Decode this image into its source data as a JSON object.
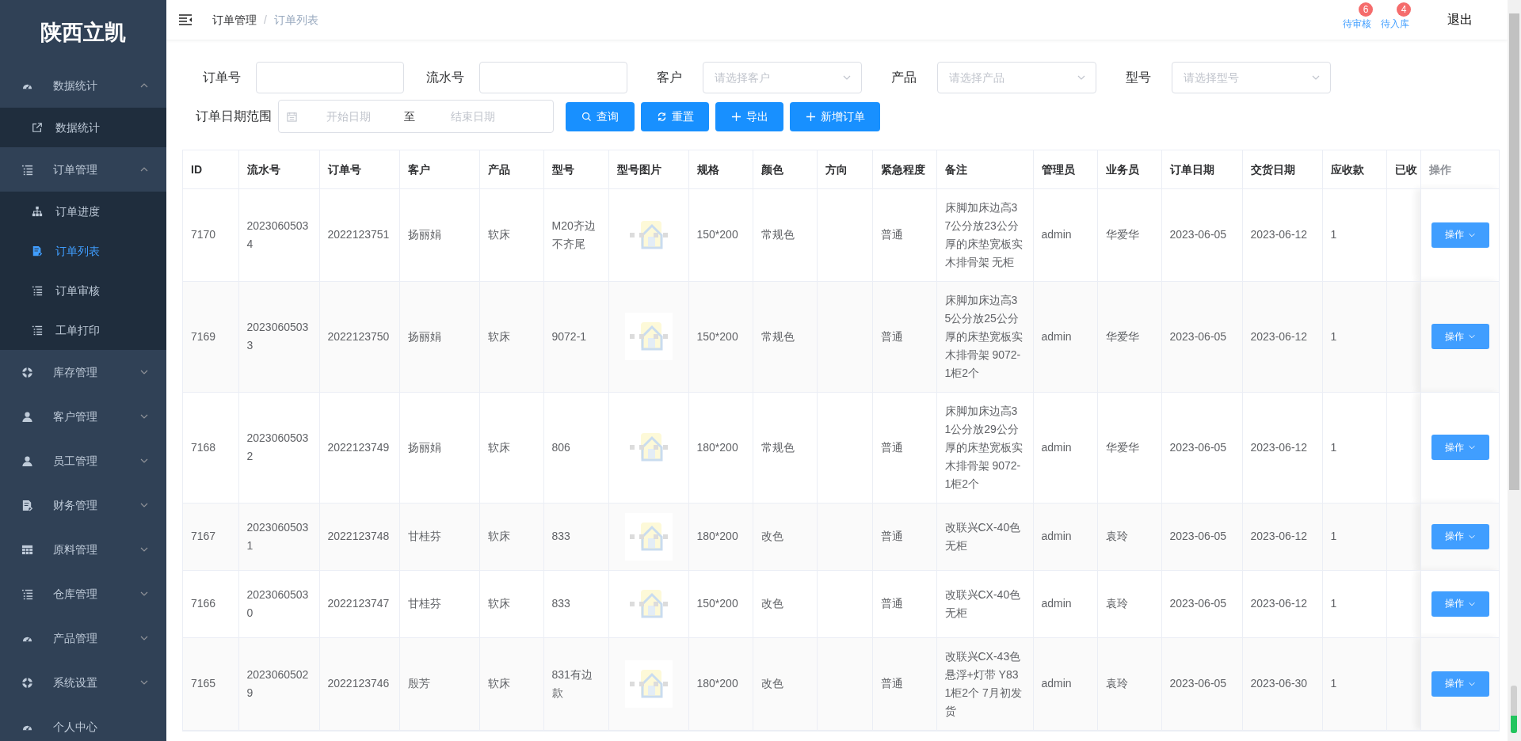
{
  "sidebar": {
    "logo": "陕西立凯",
    "items": [
      {
        "label": "数据统计",
        "expanded": true,
        "children": [
          {
            "label": "数据统计",
            "selected": false
          }
        ]
      },
      {
        "label": "订单管理",
        "expanded": true,
        "children": [
          {
            "label": "订单进度",
            "selected": false
          },
          {
            "label": "订单列表",
            "selected": true
          },
          {
            "label": "订单审核",
            "selected": false
          },
          {
            "label": "工单打印",
            "selected": false
          }
        ]
      },
      {
        "label": "库存管理",
        "expanded": false
      },
      {
        "label": "客户管理",
        "expanded": false
      },
      {
        "label": "员工管理",
        "expanded": false
      },
      {
        "label": "财务管理",
        "expanded": false
      },
      {
        "label": "原料管理",
        "expanded": false
      },
      {
        "label": "仓库管理",
        "expanded": false
      },
      {
        "label": "产品管理",
        "expanded": false
      },
      {
        "label": "系统设置",
        "expanded": false
      },
      {
        "label": "个人中心"
      }
    ]
  },
  "header": {
    "breadcrumb": [
      "订单管理",
      "订单列表"
    ],
    "breadcrumb_separator": "/",
    "links": [
      {
        "label": "待审核",
        "badge": "6"
      },
      {
        "label": "待入库",
        "badge": "4"
      }
    ],
    "logout": "退出"
  },
  "filters": {
    "fields": [
      {
        "label": "订单号",
        "kind": "input"
      },
      {
        "label": "流水号",
        "kind": "input"
      },
      {
        "label": "客户",
        "kind": "select",
        "placeholder": "请选择客户"
      },
      {
        "label": "产品",
        "kind": "select",
        "placeholder": "请选择产品"
      },
      {
        "label": "型号",
        "kind": "select",
        "placeholder": "请选择型号"
      }
    ],
    "date_range": {
      "label": "订单日期范围",
      "start_placeholder": "开始日期",
      "separator": "至",
      "end_placeholder": "结束日期"
    },
    "buttons": [
      "查询",
      "重置",
      "导出",
      "新增订单"
    ]
  },
  "table": {
    "columns": [
      "ID",
      "流水号",
      "订单号",
      "客户",
      "产品",
      "型号",
      "型号图片",
      "规格",
      "颜色",
      "方向",
      "紧急程度",
      "备注",
      "管理员",
      "业务员",
      "订单日期",
      "交货日期",
      "应收款",
      "已收",
      "操作"
    ],
    "rows": [
      {
        "id": "7170",
        "serial": "20230605034",
        "order_no": "2022123751",
        "customer": "扬丽娟",
        "product": "软床",
        "model": "M20齐边不齐尾",
        "spec": "150*200",
        "color_name": "常规色",
        "urgency": "普通",
        "remark": "床脚加床边高37公分放23公分厚的床垫宽板实木排骨架 无柜",
        "manager": "admin",
        "salesperson": "华爱华",
        "order_date": "2023-06-05",
        "delivery_date": "2023-06-12",
        "receivable": "1",
        "action": "操作"
      },
      {
        "id": "7169",
        "serial": "20230605033",
        "order_no": "2022123750",
        "customer": "扬丽娟",
        "product": "软床",
        "model": "9072-1",
        "spec": "150*200",
        "color_name": "常规色",
        "urgency": "普通",
        "remark": "床脚加床边高35公分放25公分厚的床垫宽板实木排骨架 9072-1柜2个",
        "manager": "admin",
        "salesperson": "华爱华",
        "order_date": "2023-06-05",
        "delivery_date": "2023-06-12",
        "receivable": "1",
        "action": "操作"
      },
      {
        "id": "7168",
        "serial": "20230605032",
        "order_no": "2022123749",
        "customer": "扬丽娟",
        "product": "软床",
        "model": "806",
        "spec": "180*200",
        "color_name": "常规色",
        "urgency": "普通",
        "remark": "床脚加床边高31公分放29公分厚的床垫宽板实木排骨架 9072-1柜2个",
        "manager": "admin",
        "salesperson": "华爱华",
        "order_date": "2023-06-05",
        "delivery_date": "2023-06-12",
        "receivable": "1",
        "action": "操作"
      },
      {
        "id": "7167",
        "serial": "20230605031",
        "order_no": "2022123748",
        "customer": "甘桂芬",
        "product": "软床",
        "model": "833",
        "spec": "180*200",
        "color_name": "改色",
        "urgency": "普通",
        "remark": "改联兴CX-40色无柜",
        "manager": "admin",
        "salesperson": "袁玲",
        "order_date": "2023-06-05",
        "delivery_date": "2023-06-12",
        "receivable": "1",
        "action": "操作"
      },
      {
        "id": "7166",
        "serial": "20230605030",
        "order_no": "2022123747",
        "customer": "甘桂芬",
        "product": "软床",
        "model": "833",
        "spec": "150*200",
        "color_name": "改色",
        "urgency": "普通",
        "remark": "改联兴CX-40色无柜",
        "manager": "admin",
        "salesperson": "袁玲",
        "order_date": "2023-06-05",
        "delivery_date": "2023-06-12",
        "receivable": "1",
        "action": "操作"
      },
      {
        "id": "7165",
        "serial": "20230605029",
        "order_no": "2022123746",
        "customer": "殷芳",
        "product": "软床",
        "model": "831有边款",
        "spec": "180*200",
        "color_name": "改色",
        "urgency": "普通",
        "remark": "改联兴CX-43色悬浮+灯带 Y831柜2个 7月初发货",
        "manager": "admin",
        "salesperson": "袁玲",
        "order_date": "2023-06-05",
        "delivery_date": "2023-06-30",
        "receivable": "1",
        "action": "操作"
      }
    ]
  }
}
